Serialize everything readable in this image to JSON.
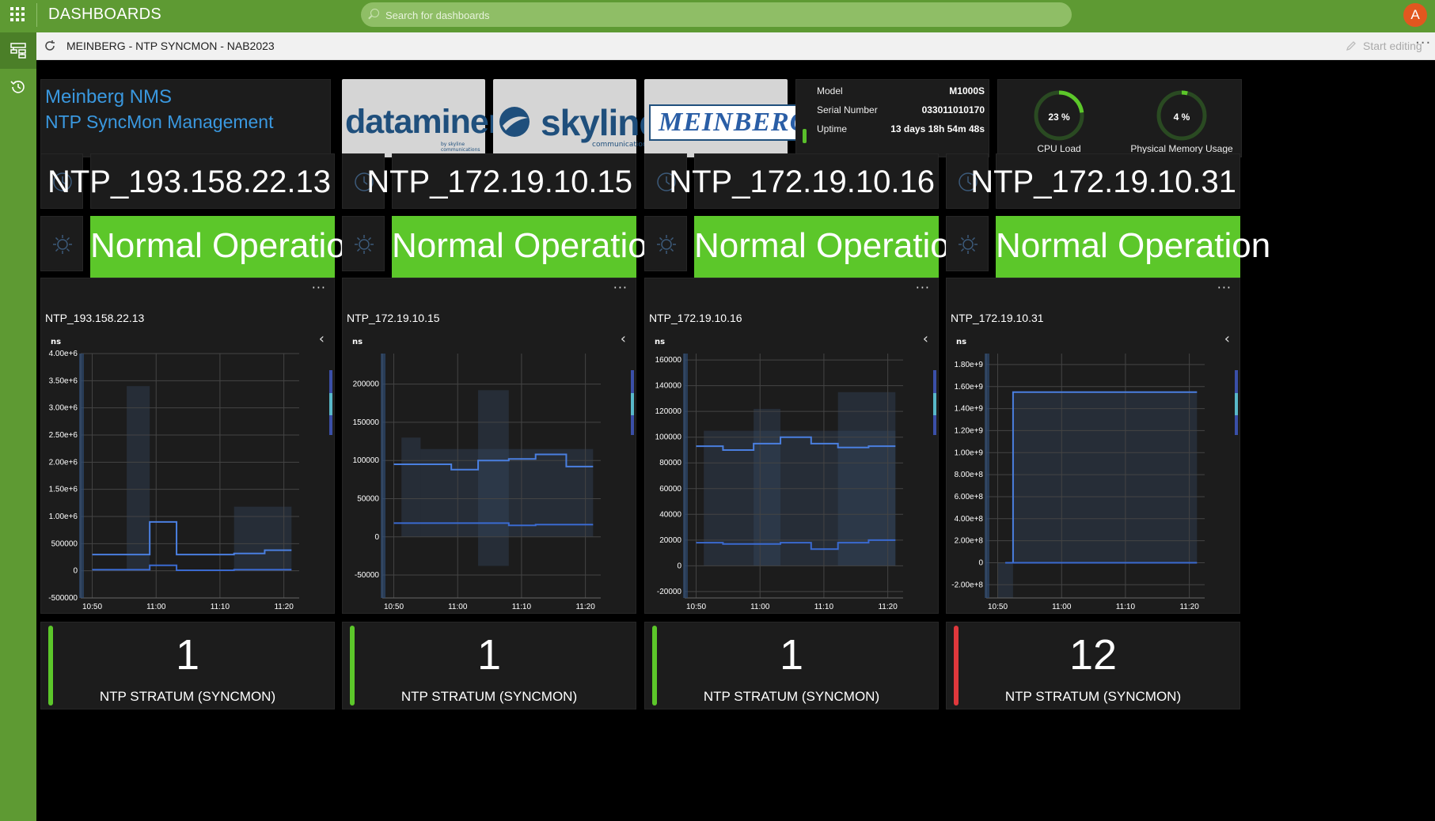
{
  "topbar": {
    "title": "DASHBOARDS",
    "search_placeholder": "Search for dashboards",
    "avatar_initial": "A"
  },
  "dashboard": {
    "name": "MEINBERG - NTP SYNCMON - NAB2023",
    "edit_label": "Start editing"
  },
  "brand": {
    "line1": "Meinberg NMS",
    "line2": "NTP SyncMon Management"
  },
  "logos": {
    "dataminer": {
      "text": "dataminer",
      "sub": "by skyline communications"
    },
    "skyline": {
      "text": "skyline",
      "sub": "communications"
    },
    "meinberg": {
      "text": "MEINBERG"
    }
  },
  "device": {
    "model_label": "Model",
    "model_value": "M1000S",
    "serial_label": "Serial Number",
    "serial_value": "033011010170",
    "uptime_label": "Uptime",
    "uptime_value": "13 days 18h 54m 48s"
  },
  "gauges": [
    {
      "value_text": "23 %",
      "value": 23,
      "label": "CPU Load"
    },
    {
      "value_text": "4 %",
      "value": 4,
      "label": "Physical Memory Usage"
    }
  ],
  "colors": {
    "status_ok": "#5cc72a",
    "status_bad": "#e0383c",
    "accent": "#3a98df",
    "line": "#4a7fe0"
  },
  "nodes": [
    {
      "name": "NTP_193.158.22.13",
      "status": "Normal Operation",
      "stratum": "1",
      "stratum_label": "NTP STRATUM (SYNCMON)",
      "stratum_state": "ok"
    },
    {
      "name": "NTP_172.19.10.15",
      "status": "Normal Operation",
      "stratum": "1",
      "stratum_label": "NTP STRATUM (SYNCMON)",
      "stratum_state": "ok"
    },
    {
      "name": "NTP_172.19.10.16",
      "status": "Normal Operation",
      "stratum": "1",
      "stratum_label": "NTP STRATUM (SYNCMON)",
      "stratum_state": "ok"
    },
    {
      "name": "NTP_172.19.10.31",
      "status": "Normal Operation",
      "stratum": "12",
      "stratum_label": "NTP STRATUM (SYNCMON)",
      "stratum_state": "bad"
    }
  ],
  "chart_data": [
    {
      "type": "line",
      "title": "NTP_193.158.22.13",
      "ylabel": "ns",
      "x": [
        "10:50",
        "11:00",
        "11:10",
        "11:20"
      ],
      "y_ticks": [
        "-500000",
        "0",
        "500000",
        "1.00e+6",
        "1.50e+6",
        "2.00e+6",
        "2.50e+6",
        "3.00e+6",
        "3.50e+6",
        "4.00e+6"
      ],
      "ylim": [
        -500000,
        4000000
      ],
      "step_x": [
        10.48,
        10.57,
        10.63,
        10.7,
        10.78,
        10.85,
        10.93,
        11.0
      ],
      "series": [
        {
          "values": [
            300000,
            300000,
            900000,
            300000,
            300000,
            320000,
            380000,
            380000
          ]
        },
        {
          "values": [
            20000,
            20000,
            100000,
            10000,
            10000,
            20000,
            20000,
            20000
          ]
        }
      ],
      "bands": [
        {
          "x0": 10.57,
          "x1": 10.63,
          "lo": 0,
          "hi": 3400000
        },
        {
          "x0": 10.85,
          "x1": 11.0,
          "lo": 0,
          "hi": 1180000
        }
      ]
    },
    {
      "type": "line",
      "title": "NTP_172.19.10.15",
      "ylabel": "ns",
      "x": [
        "10:50",
        "11:00",
        "11:10",
        "11:20"
      ],
      "y_ticks": [
        "-50000",
        "0",
        "50000",
        "100000",
        "150000",
        "200000"
      ],
      "ylim": [
        -80000,
        240000
      ],
      "step_x": [
        10.48,
        10.55,
        10.63,
        10.7,
        10.78,
        10.85,
        10.93,
        11.0
      ],
      "series": [
        {
          "values": [
            95000,
            95000,
            88000,
            100000,
            102000,
            108000,
            92000,
            92000
          ]
        },
        {
          "values": [
            18000,
            18000,
            18000,
            18000,
            15000,
            16000,
            16000,
            16000
          ]
        }
      ],
      "bands": [
        {
          "x0": 10.5,
          "x1": 10.55,
          "lo": 0,
          "hi": 130000
        },
        {
          "x0": 10.7,
          "x1": 10.78,
          "lo": -38000,
          "hi": 192000
        },
        {
          "x0": 10.55,
          "x1": 11.0,
          "lo": 0,
          "hi": 115000
        }
      ]
    },
    {
      "type": "line",
      "title": "NTP_172.19.10.16",
      "ylabel": "ns",
      "x": [
        "10:50",
        "11:00",
        "11:10",
        "11:20"
      ],
      "y_ticks": [
        "-20000",
        "0",
        "20000",
        "40000",
        "60000",
        "80000",
        "100000",
        "120000",
        "140000",
        "160000"
      ],
      "ylim": [
        -25000,
        165000
      ],
      "step_x": [
        10.48,
        10.55,
        10.63,
        10.7,
        10.78,
        10.85,
        10.93,
        11.0
      ],
      "series": [
        {
          "values": [
            93000,
            90000,
            95000,
            100000,
            95000,
            92000,
            93000,
            93000
          ]
        },
        {
          "values": [
            18000,
            17000,
            17000,
            18000,
            13000,
            18000,
            20000,
            20000
          ]
        }
      ],
      "bands": [
        {
          "x0": 10.63,
          "x1": 10.7,
          "lo": 0,
          "hi": 122000
        },
        {
          "x0": 10.85,
          "x1": 11.0,
          "lo": 0,
          "hi": 135000
        },
        {
          "x0": 10.5,
          "x1": 11.0,
          "lo": 0,
          "hi": 105000
        }
      ]
    },
    {
      "type": "line",
      "title": "NTP_172.19.10.31",
      "ylabel": "ns",
      "x": [
        "10:50",
        "11:00",
        "11:10",
        "11:20"
      ],
      "y_ticks": [
        "-2.00e+8",
        "0",
        "2.00e+8",
        "4.00e+8",
        "6.00e+8",
        "8.00e+8",
        "1.00e+9",
        "1.20e+9",
        "1.40e+9",
        "1.60e+9",
        "1.80e+9"
      ],
      "ylim": [
        -320000000,
        1900000000
      ],
      "step_x": [
        10.5,
        10.52,
        11.0
      ],
      "series": [
        {
          "values": [
            0,
            1550000000,
            1550000000
          ]
        },
        {
          "values": [
            0,
            0,
            0
          ]
        }
      ],
      "bands": [
        {
          "x0": 10.52,
          "x1": 11.0,
          "lo": 0,
          "hi": 1550000000
        },
        {
          "x0": 10.48,
          "x1": 10.52,
          "lo": -320000000,
          "hi": 0
        }
      ]
    }
  ]
}
